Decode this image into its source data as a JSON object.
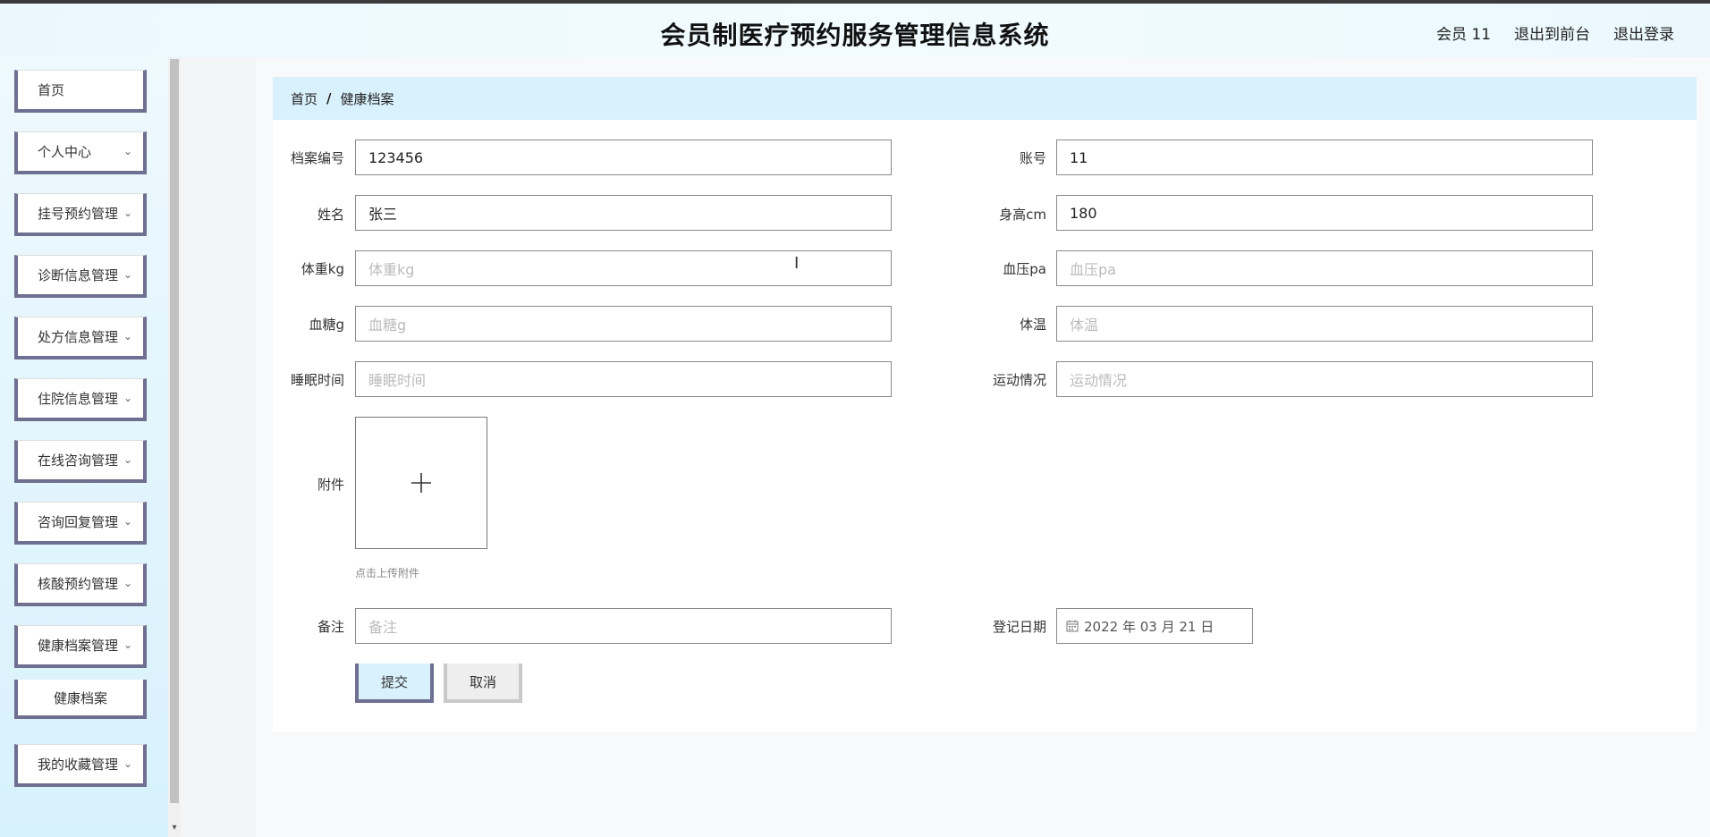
{
  "header": {
    "title": "会员制医疗预约服务管理信息系统",
    "user_link": "会员 11",
    "front_link": "退出到前台",
    "logout_link": "退出登录"
  },
  "sidebar": {
    "items": [
      {
        "label": "首页"
      },
      {
        "label": "个人中心"
      },
      {
        "label": "挂号预约管理"
      },
      {
        "label": "诊断信息管理"
      },
      {
        "label": "处方信息管理"
      },
      {
        "label": "住院信息管理"
      },
      {
        "label": "在线咨询管理"
      },
      {
        "label": "咨询回复管理"
      },
      {
        "label": "核酸预约管理"
      },
      {
        "label": "健康档案管理"
      },
      {
        "label": "我的收藏管理"
      }
    ],
    "sub_item": "健康档案"
  },
  "breadcrumb": {
    "home": "首页",
    "separator": "/",
    "current": "健康档案"
  },
  "form": {
    "record_no": {
      "label": "档案编号",
      "value": "123456"
    },
    "account": {
      "label": "账号",
      "value": "11"
    },
    "name": {
      "label": "姓名",
      "value": "张三"
    },
    "height": {
      "label": "身高cm",
      "value": "180"
    },
    "weight": {
      "label": "体重kg",
      "placeholder": "体重kg"
    },
    "blood_pressure": {
      "label": "血压pa",
      "placeholder": "血压pa"
    },
    "blood_sugar": {
      "label": "血糖g",
      "placeholder": "血糖g"
    },
    "temperature": {
      "label": "体温",
      "placeholder": "体温"
    },
    "sleep": {
      "label": "睡眠时间",
      "placeholder": "睡眠时间"
    },
    "exercise": {
      "label": "运动情况",
      "placeholder": "运动情况"
    },
    "attachment": {
      "label": "附件",
      "hint": "点击上传附件"
    },
    "remark": {
      "label": "备注",
      "placeholder": "备注"
    },
    "reg_date": {
      "label": "登记日期",
      "value": "2022 年 03 月 21 日"
    },
    "submit_label": "提交",
    "cancel_label": "取消"
  },
  "icons": {
    "chevron": "chevron-down-icon",
    "calendar": "calendar-icon",
    "plus": "plus-icon"
  }
}
